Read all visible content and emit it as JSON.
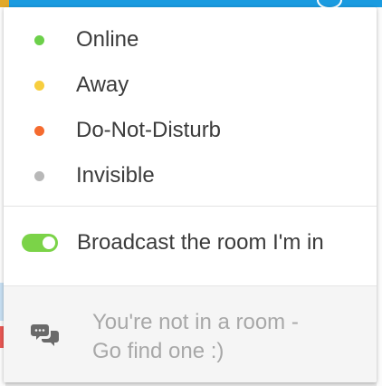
{
  "status_menu": {
    "items": [
      {
        "label": "Online",
        "color": "#6cd04a"
      },
      {
        "label": "Away",
        "color": "#f7ce3e"
      },
      {
        "label": "Do-Not-Disturb",
        "color": "#f56b2f"
      },
      {
        "label": "Invisible",
        "color": "#b8b8b8"
      }
    ]
  },
  "broadcast": {
    "label": "Broadcast the room I'm in",
    "enabled": true,
    "color": "#7bd348"
  },
  "room": {
    "message_line1": "You're not in a room -",
    "message_line2": "Go find one :)",
    "icon": "chat-bubbles-icon"
  }
}
